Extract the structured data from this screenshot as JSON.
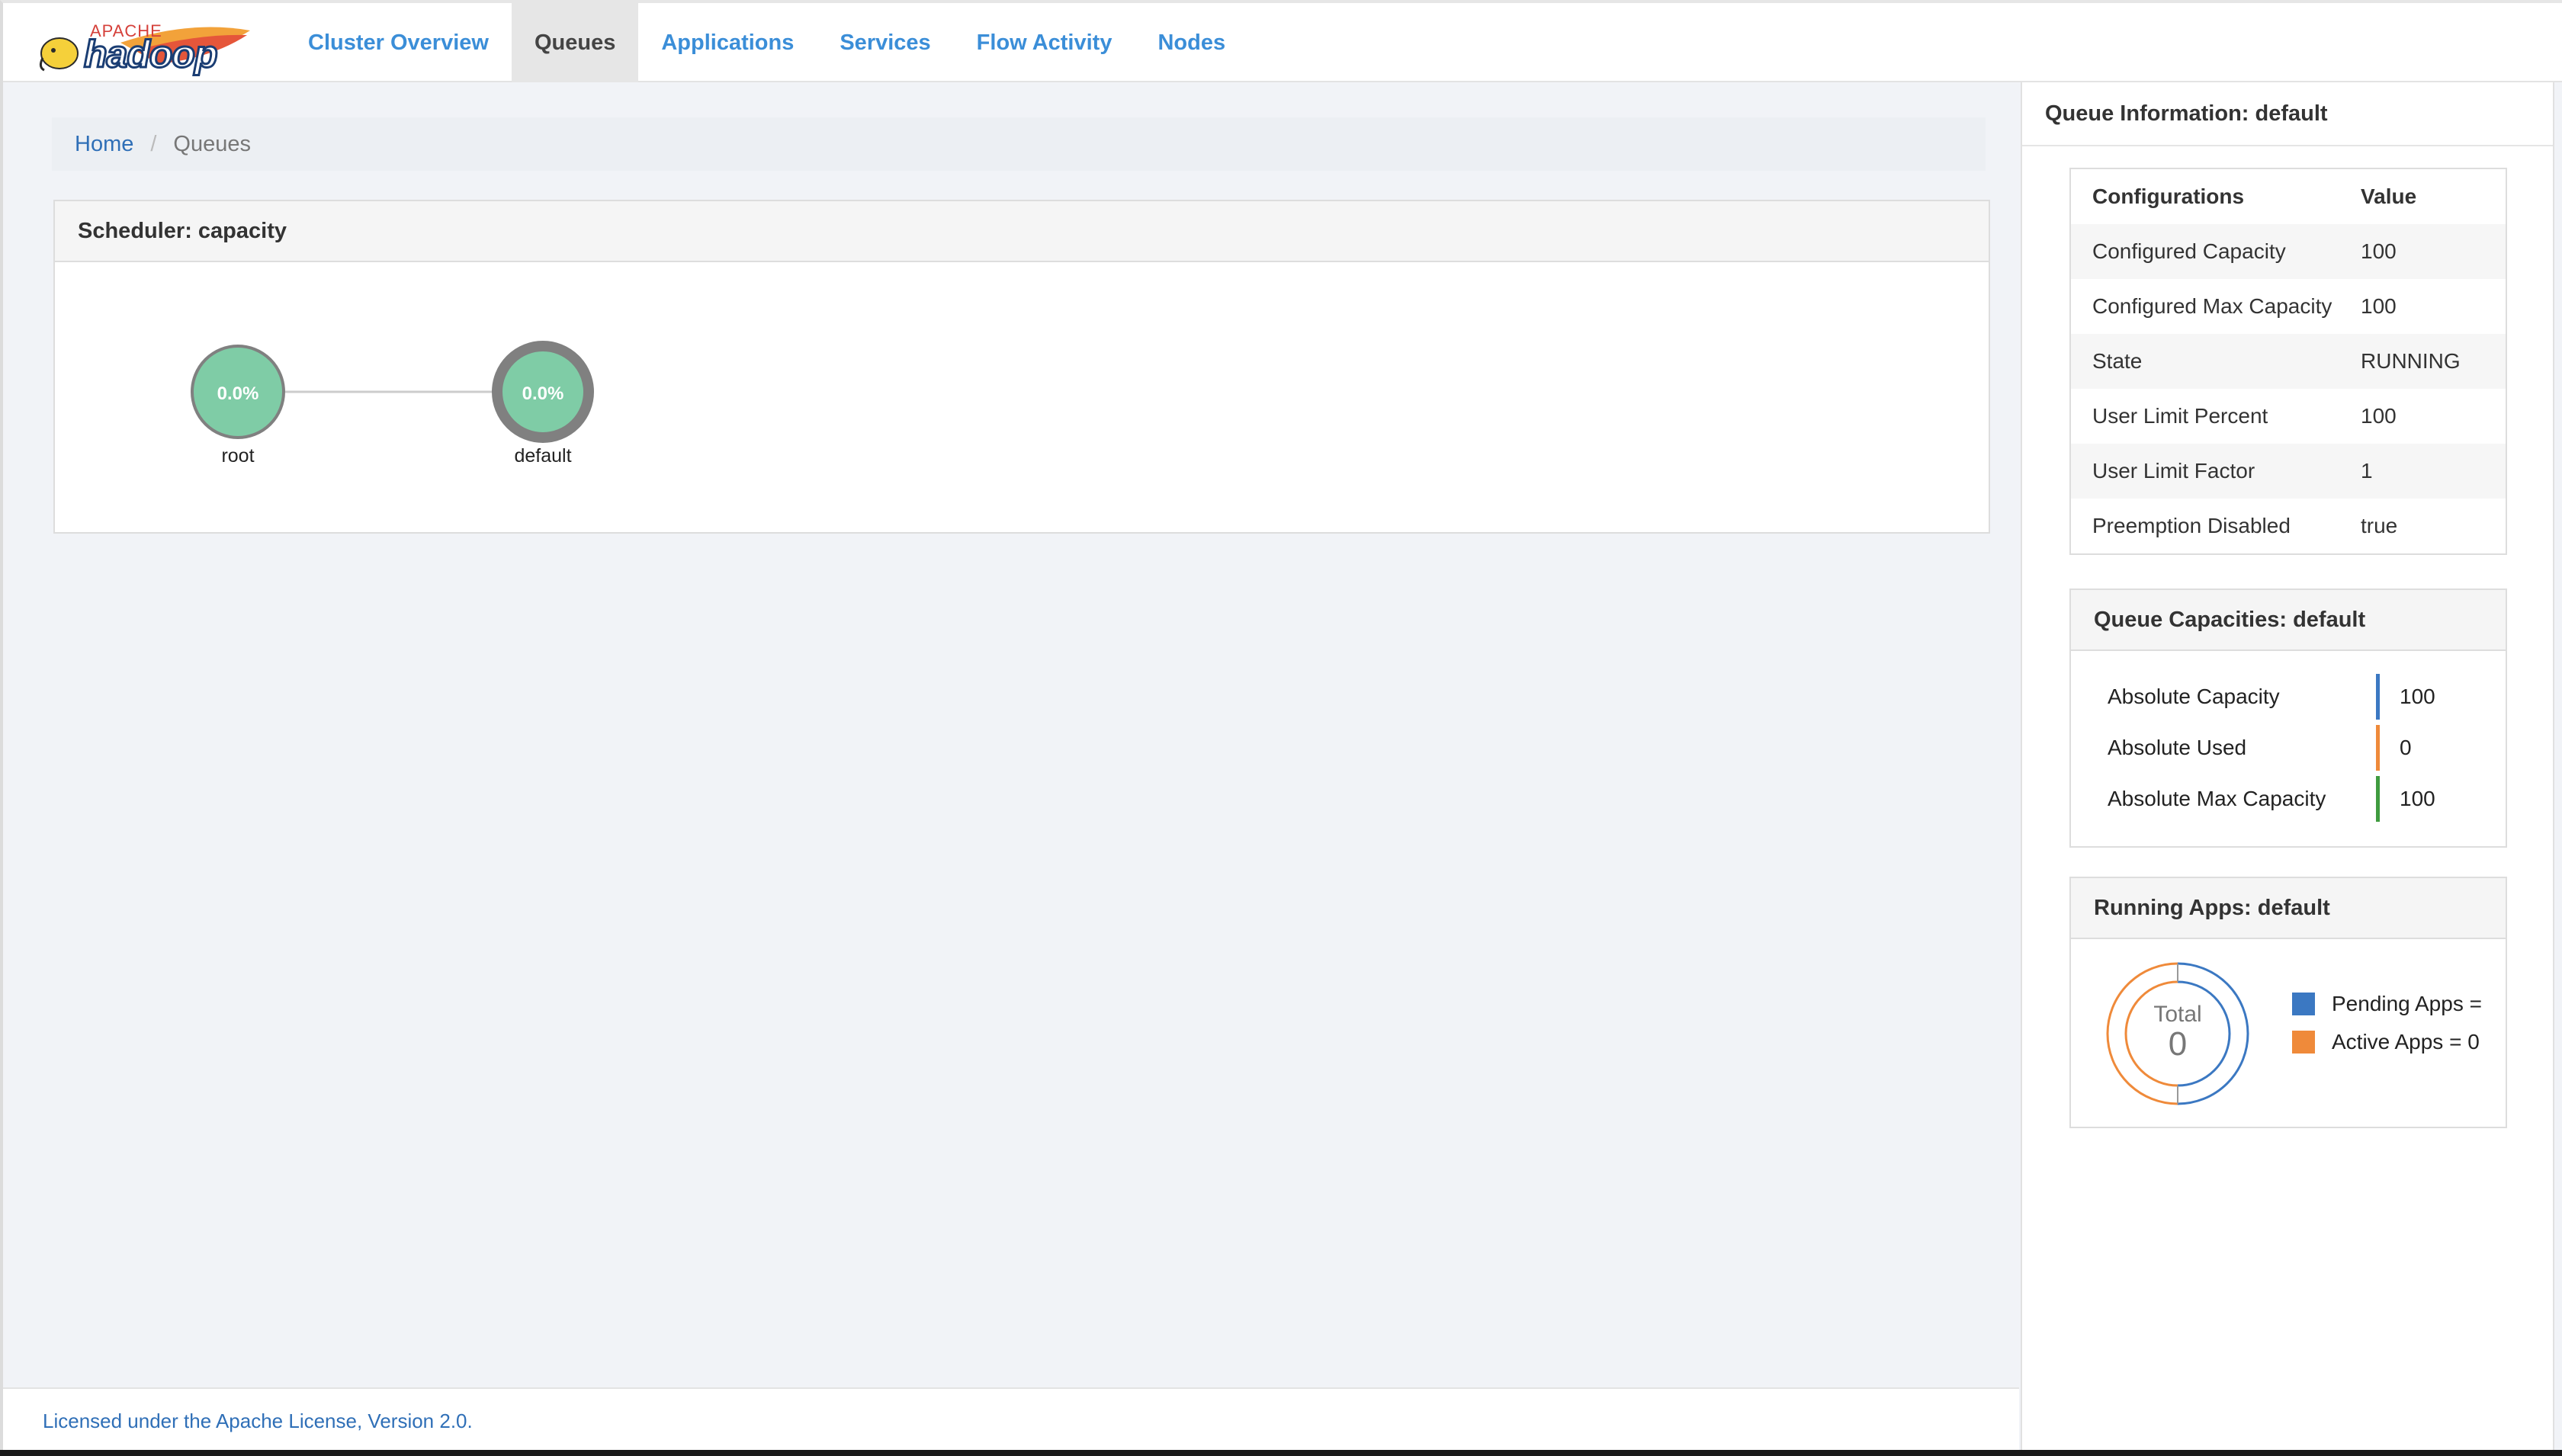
{
  "header": {
    "logo_top": "APACHE",
    "logo_main": "hadoop",
    "nav": [
      {
        "label": "Cluster Overview",
        "active": false
      },
      {
        "label": "Queues",
        "active": true
      },
      {
        "label": "Applications",
        "active": false
      },
      {
        "label": "Services",
        "active": false
      },
      {
        "label": "Flow Activity",
        "active": false
      },
      {
        "label": "Nodes",
        "active": false
      }
    ]
  },
  "breadcrumb": {
    "home": "Home",
    "separator": "/",
    "current": "Queues"
  },
  "scheduler": {
    "title": "Scheduler: capacity",
    "queues": [
      {
        "name": "root",
        "usage": "0.0%",
        "selected": false
      },
      {
        "name": "default",
        "usage": "0.0%",
        "selected": true
      }
    ],
    "node_color": "#7fcca6",
    "selected_ring_color": "#808080"
  },
  "queue_info": {
    "title": "Queue Information: default",
    "table_header": {
      "col1": "Configurations",
      "col2": "Value"
    },
    "rows": [
      {
        "label": "Configured Capacity",
        "value": "100"
      },
      {
        "label": "Configured Max Capacity",
        "value": "100"
      },
      {
        "label": "State",
        "value": "RUNNING"
      },
      {
        "label": "User Limit Percent",
        "value": "100"
      },
      {
        "label": "User Limit Factor",
        "value": "1"
      },
      {
        "label": "Preemption Disabled",
        "value": "true"
      }
    ]
  },
  "capacities": {
    "title": "Queue Capacities: default",
    "rows": [
      {
        "label": "Absolute Capacity",
        "value": "100",
        "color": "#3b78c2"
      },
      {
        "label": "Absolute Used",
        "value": "0",
        "color": "#ef8a3a"
      },
      {
        "label": "Absolute Max Capacity",
        "value": "100",
        "color": "#3f9b3f"
      }
    ]
  },
  "running_apps": {
    "title": "Running Apps: default",
    "total_label": "Total",
    "total_value": "0",
    "legend": [
      {
        "label": "Pending Apps =",
        "color": "#3b78c2"
      },
      {
        "label": "Active Apps = 0",
        "color": "#ef8a3a"
      }
    ]
  },
  "footer": {
    "text": "Licensed under the Apache License, Version 2.0."
  }
}
